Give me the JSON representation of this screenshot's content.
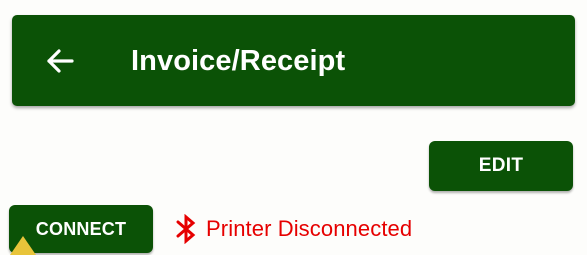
{
  "header": {
    "back_icon": "arrow-left-icon",
    "title": "Invoice/Receipt"
  },
  "actions": {
    "edit_label": "EDIT",
    "connect_label": "CONNECT"
  },
  "printer_status": {
    "icon": "bluetooth-icon",
    "text": "Printer Disconnected",
    "color": "#e60000"
  },
  "colors": {
    "primary": "#0b5206",
    "on_primary": "#ffffff",
    "background": "#fdfdfb",
    "accent_marker": "#e8c43a"
  }
}
